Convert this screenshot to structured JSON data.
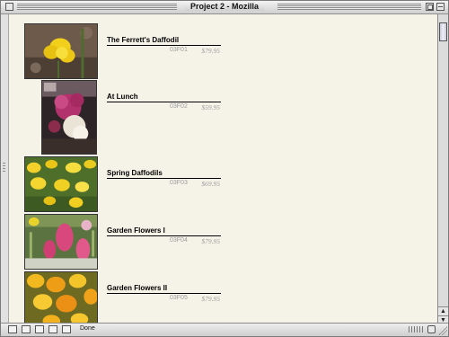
{
  "window": {
    "title": "Project 2 - Mozilla"
  },
  "products": [
    {
      "name": "The Ferrett's Daffodil",
      "code": "03F01",
      "price": "$79.95",
      "image": "yellow-daffodil-photo"
    },
    {
      "name": "At Lunch",
      "code": "03F02",
      "price": "$59.95",
      "image": "pink-and-white-flower-arrangement-photo"
    },
    {
      "name": "Spring Daffodils",
      "code": "03F03",
      "price": "$69.95",
      "image": "daffodil-field-photo"
    },
    {
      "name": "Garden Flowers I",
      "code": "03F04",
      "price": "$79.95",
      "image": "pink-hyacinths-photo"
    },
    {
      "name": "Garden Flowers II",
      "code": "03F05",
      "price": "$79.95",
      "image": "orange-yellow-flowers-photo"
    }
  ],
  "statusbar": {
    "status_text": "Done"
  },
  "colors": {
    "page_background": "#f5f3e8",
    "meta_text": "#9c9c9c"
  }
}
